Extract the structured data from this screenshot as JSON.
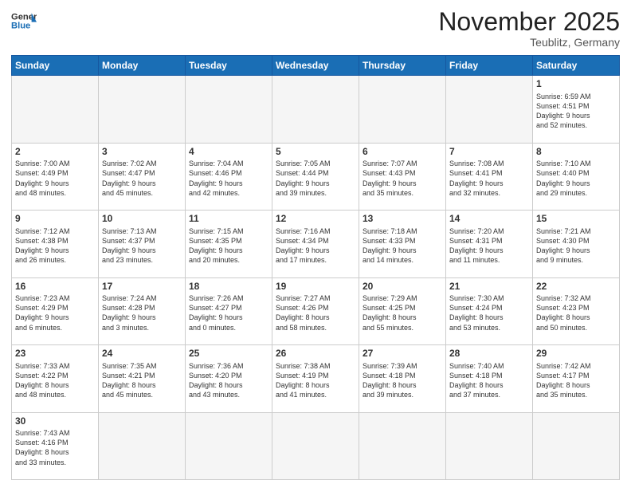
{
  "header": {
    "logo_general": "General",
    "logo_blue": "Blue",
    "month_title": "November 2025",
    "location": "Teublitz, Germany"
  },
  "days_of_week": [
    "Sunday",
    "Monday",
    "Tuesday",
    "Wednesday",
    "Thursday",
    "Friday",
    "Saturday"
  ],
  "weeks": [
    [
      {
        "num": "",
        "info": "",
        "empty": true
      },
      {
        "num": "",
        "info": "",
        "empty": true
      },
      {
        "num": "",
        "info": "",
        "empty": true
      },
      {
        "num": "",
        "info": "",
        "empty": true
      },
      {
        "num": "",
        "info": "",
        "empty": true
      },
      {
        "num": "",
        "info": "",
        "empty": true
      },
      {
        "num": "1",
        "info": "Sunrise: 6:59 AM\nSunset: 4:51 PM\nDaylight: 9 hours\nand 52 minutes.",
        "empty": false
      }
    ],
    [
      {
        "num": "2",
        "info": "Sunrise: 7:00 AM\nSunset: 4:49 PM\nDaylight: 9 hours\nand 48 minutes.",
        "empty": false
      },
      {
        "num": "3",
        "info": "Sunrise: 7:02 AM\nSunset: 4:47 PM\nDaylight: 9 hours\nand 45 minutes.",
        "empty": false
      },
      {
        "num": "4",
        "info": "Sunrise: 7:04 AM\nSunset: 4:46 PM\nDaylight: 9 hours\nand 42 minutes.",
        "empty": false
      },
      {
        "num": "5",
        "info": "Sunrise: 7:05 AM\nSunset: 4:44 PM\nDaylight: 9 hours\nand 39 minutes.",
        "empty": false
      },
      {
        "num": "6",
        "info": "Sunrise: 7:07 AM\nSunset: 4:43 PM\nDaylight: 9 hours\nand 35 minutes.",
        "empty": false
      },
      {
        "num": "7",
        "info": "Sunrise: 7:08 AM\nSunset: 4:41 PM\nDaylight: 9 hours\nand 32 minutes.",
        "empty": false
      },
      {
        "num": "8",
        "info": "Sunrise: 7:10 AM\nSunset: 4:40 PM\nDaylight: 9 hours\nand 29 minutes.",
        "empty": false
      }
    ],
    [
      {
        "num": "9",
        "info": "Sunrise: 7:12 AM\nSunset: 4:38 PM\nDaylight: 9 hours\nand 26 minutes.",
        "empty": false
      },
      {
        "num": "10",
        "info": "Sunrise: 7:13 AM\nSunset: 4:37 PM\nDaylight: 9 hours\nand 23 minutes.",
        "empty": false
      },
      {
        "num": "11",
        "info": "Sunrise: 7:15 AM\nSunset: 4:35 PM\nDaylight: 9 hours\nand 20 minutes.",
        "empty": false
      },
      {
        "num": "12",
        "info": "Sunrise: 7:16 AM\nSunset: 4:34 PM\nDaylight: 9 hours\nand 17 minutes.",
        "empty": false
      },
      {
        "num": "13",
        "info": "Sunrise: 7:18 AM\nSunset: 4:33 PM\nDaylight: 9 hours\nand 14 minutes.",
        "empty": false
      },
      {
        "num": "14",
        "info": "Sunrise: 7:20 AM\nSunset: 4:31 PM\nDaylight: 9 hours\nand 11 minutes.",
        "empty": false
      },
      {
        "num": "15",
        "info": "Sunrise: 7:21 AM\nSunset: 4:30 PM\nDaylight: 9 hours\nand 9 minutes.",
        "empty": false
      }
    ],
    [
      {
        "num": "16",
        "info": "Sunrise: 7:23 AM\nSunset: 4:29 PM\nDaylight: 9 hours\nand 6 minutes.",
        "empty": false
      },
      {
        "num": "17",
        "info": "Sunrise: 7:24 AM\nSunset: 4:28 PM\nDaylight: 9 hours\nand 3 minutes.",
        "empty": false
      },
      {
        "num": "18",
        "info": "Sunrise: 7:26 AM\nSunset: 4:27 PM\nDaylight: 9 hours\nand 0 minutes.",
        "empty": false
      },
      {
        "num": "19",
        "info": "Sunrise: 7:27 AM\nSunset: 4:26 PM\nDaylight: 8 hours\nand 58 minutes.",
        "empty": false
      },
      {
        "num": "20",
        "info": "Sunrise: 7:29 AM\nSunset: 4:25 PM\nDaylight: 8 hours\nand 55 minutes.",
        "empty": false
      },
      {
        "num": "21",
        "info": "Sunrise: 7:30 AM\nSunset: 4:24 PM\nDaylight: 8 hours\nand 53 minutes.",
        "empty": false
      },
      {
        "num": "22",
        "info": "Sunrise: 7:32 AM\nSunset: 4:23 PM\nDaylight: 8 hours\nand 50 minutes.",
        "empty": false
      }
    ],
    [
      {
        "num": "23",
        "info": "Sunrise: 7:33 AM\nSunset: 4:22 PM\nDaylight: 8 hours\nand 48 minutes.",
        "empty": false
      },
      {
        "num": "24",
        "info": "Sunrise: 7:35 AM\nSunset: 4:21 PM\nDaylight: 8 hours\nand 45 minutes.",
        "empty": false
      },
      {
        "num": "25",
        "info": "Sunrise: 7:36 AM\nSunset: 4:20 PM\nDaylight: 8 hours\nand 43 minutes.",
        "empty": false
      },
      {
        "num": "26",
        "info": "Sunrise: 7:38 AM\nSunset: 4:19 PM\nDaylight: 8 hours\nand 41 minutes.",
        "empty": false
      },
      {
        "num": "27",
        "info": "Sunrise: 7:39 AM\nSunset: 4:18 PM\nDaylight: 8 hours\nand 39 minutes.",
        "empty": false
      },
      {
        "num": "28",
        "info": "Sunrise: 7:40 AM\nSunset: 4:18 PM\nDaylight: 8 hours\nand 37 minutes.",
        "empty": false
      },
      {
        "num": "29",
        "info": "Sunrise: 7:42 AM\nSunset: 4:17 PM\nDaylight: 8 hours\nand 35 minutes.",
        "empty": false
      }
    ],
    [
      {
        "num": "30",
        "info": "Sunrise: 7:43 AM\nSunset: 4:16 PM\nDaylight: 8 hours\nand 33 minutes.",
        "empty": false
      },
      {
        "num": "",
        "info": "",
        "empty": true
      },
      {
        "num": "",
        "info": "",
        "empty": true
      },
      {
        "num": "",
        "info": "",
        "empty": true
      },
      {
        "num": "",
        "info": "",
        "empty": true
      },
      {
        "num": "",
        "info": "",
        "empty": true
      },
      {
        "num": "",
        "info": "",
        "empty": true
      }
    ]
  ]
}
